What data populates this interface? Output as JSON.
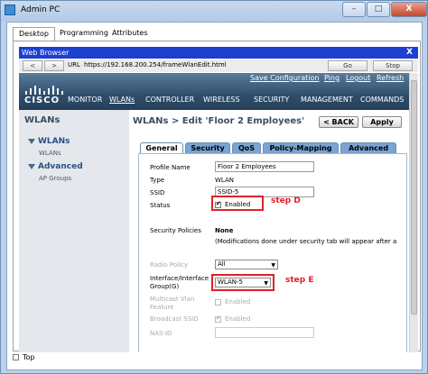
{
  "window": {
    "title": "Admin PC",
    "min": "–",
    "max": "□",
    "close": "X"
  },
  "app_tabs": [
    "Desktop",
    "Programming",
    "Attributes"
  ],
  "browser": {
    "title": "Web Browser",
    "close": "X",
    "back": "<",
    "forward": ">",
    "url_label": "URL",
    "url": "https://192.168.200.254/frameWlanEdit.html",
    "go": "Go",
    "stop": "Stop"
  },
  "header": {
    "top_links": {
      "save": "Save Configuration",
      "ping": "Ping",
      "logout": "Logout",
      "refresh": "Refresh"
    },
    "logo": "CISCO",
    "menu": [
      "MONITOR",
      "WLANs",
      "CONTROLLER",
      "WIRELESS",
      "SECURITY",
      "MANAGEMENT",
      "COMMANDS"
    ]
  },
  "sidebar": {
    "title": "WLANs",
    "groups": [
      {
        "label": "WLANs",
        "sub": "WLANs"
      },
      {
        "label": "Advanced",
        "sub": "AP Groups"
      }
    ]
  },
  "content": {
    "title": "WLANs > Edit  'Floor 2 Employees'",
    "back": "< BACK",
    "apply": "Apply",
    "tabs": [
      "General",
      "Security",
      "QoS",
      "Policy-Mapping",
      "Advanced"
    ],
    "form": {
      "profile_name_label": "Profile Name",
      "profile_name": "Floor 2 Employees",
      "type_label": "Type",
      "type": "WLAN",
      "ssid_label": "SSID",
      "ssid": "SSID-5",
      "status_label": "Status",
      "status_value": "Enabled",
      "status_checked": true,
      "security_label": "Security Policies",
      "security_value": "None",
      "security_note": "(Modifications done under security tab will appear after a",
      "radio_label": "Radio Policy",
      "radio_value": "All",
      "interface_label": "Interface/Interface Group(G)",
      "interface_value": "WLAN-5",
      "multicast_label": "Multicast Vlan Feature",
      "multicast_value": "Enabled",
      "broadcast_label": "Broadcast SSID",
      "broadcast_value": "Enabled",
      "nas_label": "NAS-ID"
    },
    "annotations": {
      "step_d": "step D",
      "step_e": "step E"
    }
  },
  "footer": {
    "top_label": "Top"
  },
  "colors": {
    "accent_red": "#e0202a",
    "header_blue": "#2f4e6c",
    "tab_blue": "#7aa4d1"
  }
}
